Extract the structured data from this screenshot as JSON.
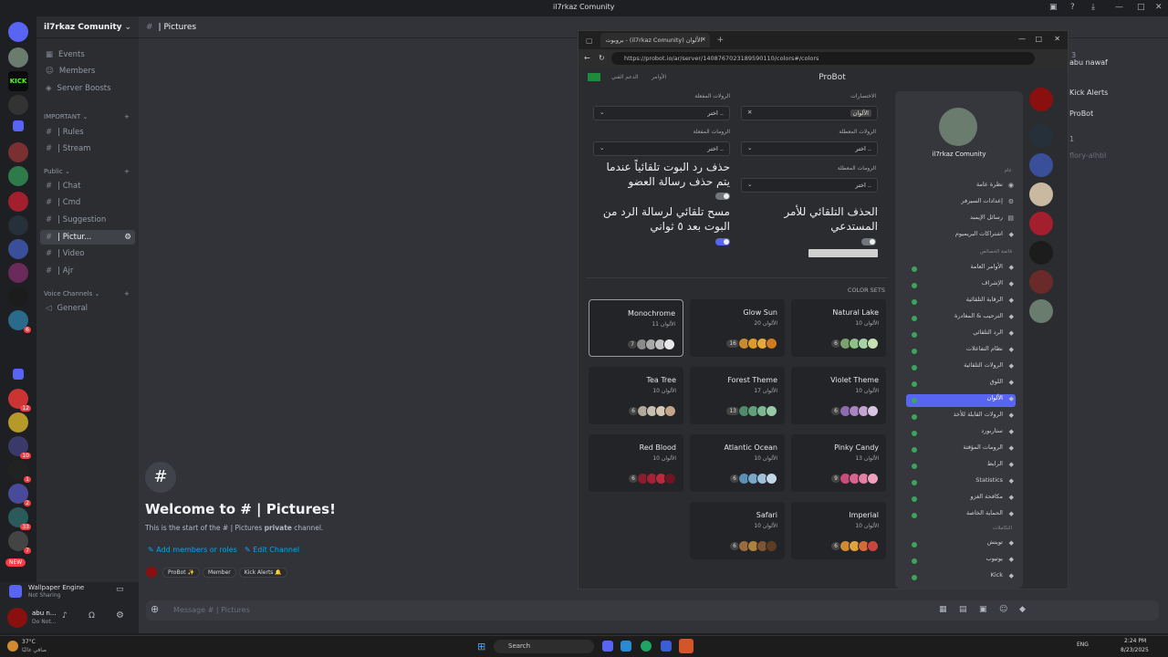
{
  "window": {
    "title": "il7rkaz Comunity"
  },
  "server": {
    "name": "il7rkaz Comunity",
    "badges": [
      "6",
      "12",
      "1",
      "10",
      "1",
      "2",
      "33",
      "7",
      "NEW"
    ]
  },
  "nav": {
    "events": "Events",
    "members": "Members",
    "boosts": "Server Boosts"
  },
  "categories": {
    "important": "IMPORTANT",
    "public": "Public",
    "voice": "Voice Channels"
  },
  "channels": {
    "rules": "| Rules",
    "stream": "| Stream",
    "chat": "| Chat",
    "cmd": "| Cmd",
    "suggestion": "| Suggestion",
    "pictures": "| Pictur...",
    "video": "| Video",
    "ajr": "| Ajr",
    "general": "General"
  },
  "header": {
    "channel": "| Pictures"
  },
  "welcome": {
    "title": "Welcome to # | Pictures!",
    "desc_a": "This is the start of the # ",
    "desc_b": "| Pictures ",
    "desc_c": "private",
    "desc_d": " channel.",
    "add": "Add members or roles",
    "edit": "Edit Channel",
    "roles": [
      "ProBot ✨",
      "Member",
      "Kick Alerts 🔔"
    ]
  },
  "composer": {
    "placeholder": "Message # | Pictures"
  },
  "user": {
    "name": "abu n...",
    "status": "Do Not...",
    "app": "Wallpaper Engine",
    "app_status": "Not Sharing"
  },
  "members_ghost": {
    "a": "abu nawaf",
    "b": "Kick Alerts",
    "c": "ProBot",
    "app": "APP",
    "d": "1",
    "e": "flory-alhbl",
    "f": "3"
  },
  "browser": {
    "tab": "بروبوت - (il7rkaz Comunity) الألوان",
    "url": "https://probot.io/ar/server/1408767023189590110/colors#/colors"
  },
  "probot": {
    "title": "ProBot",
    "support": "الدعم الفني",
    "commands": "الأوامر",
    "guild": "il7rkaz Comunity"
  },
  "form": {
    "l1": "الرولات المفعلة",
    "l2": "الاختصارات",
    "l3": "الرومات المفعلة",
    "l4": "الرولات المعطلة",
    "l5": "الرومات المعطلة",
    "choose": "اختر ..",
    "chip": "الألوان",
    "t1": "حذف رد البوت تلقائياً عندما يتم حذف رسالة العضو",
    "t2": "مسح تلقائي لرسالة الرد من البوت بعد ٥ ثواني",
    "t3": "الحذف التلقائي للأمر المستدعي"
  },
  "colorsets": {
    "label": "COLOR SETS",
    "items": [
      {
        "name": "Natural Lake",
        "count": "10 الألوان",
        "n": "6",
        "colors": [
          "#7aa06b",
          "#8fbf88",
          "#a6d4a6",
          "#c7e0b3"
        ]
      },
      {
        "name": "Glow Sun",
        "count": "20 الألوان",
        "n": "16",
        "colors": [
          "#c9892f",
          "#dc9a2c",
          "#e7a83a",
          "#d17b20"
        ]
      },
      {
        "name": "Monochrome",
        "count": "11 الألوان",
        "n": "7",
        "colors": [
          "#8a8a8a",
          "#a8a8a8",
          "#c4c4c4",
          "#e8e8e8"
        ]
      },
      {
        "name": "Violet Theme",
        "count": "10 الألوان",
        "n": "6",
        "colors": [
          "#8e6bb0",
          "#a884c0",
          "#c4a3d3",
          "#d8c4e3"
        ]
      },
      {
        "name": "Forest Theme",
        "count": "17 الألوان",
        "n": "13",
        "colors": [
          "#4f8a6a",
          "#62a07c",
          "#7bb891",
          "#96c9a6"
        ]
      },
      {
        "name": "Tea Tree",
        "count": "10 الألوان",
        "n": "6",
        "colors": [
          "#b0a89a",
          "#c6bdb0",
          "#d4c6b2",
          "#c4a58a"
        ]
      },
      {
        "name": "Pinky Candy",
        "count": "13 الألوان",
        "n": "9",
        "colors": [
          "#c94d7a",
          "#d9638e",
          "#e47fa4",
          "#eca0bb"
        ]
      },
      {
        "name": "Atlantic Ocean",
        "count": "10 الألوان",
        "n": "6",
        "colors": [
          "#5c8fb5",
          "#7aa7c9",
          "#9ec0d9",
          "#c3d8e7"
        ]
      },
      {
        "name": "Red Blood",
        "count": "10 الألوان",
        "n": "6",
        "colors": [
          "#8a1d2e",
          "#a32234",
          "#b82a3c",
          "#6e1523"
        ]
      },
      {
        "name": "Imperial",
        "count": "10 الألوان",
        "n": "6",
        "colors": [
          "#d18a2f",
          "#e0a33b",
          "#d4693a",
          "#c9463f"
        ]
      },
      {
        "name": "Safari",
        "count": "10 الألوان",
        "n": "6",
        "colors": [
          "#9a6b3d",
          "#b0803f",
          "#7d5530",
          "#5c3c22"
        ]
      }
    ]
  },
  "menu": {
    "general": "عام",
    "s1": "نظرة عامة",
    "s2": "إعدادات السيرفر",
    "s3": "رسائل الإيمبد",
    "s4": "اشتراكات البريميوم",
    "fsec": "قائمة الخصائص",
    "items": [
      "الأوامر العامة",
      "الإشراف",
      "الرقابة التلقائية",
      "الترحيب & المغادرة",
      "الرد التلقائي",
      "نظام التفاعلات",
      "الرولات التلقائية",
      "اللوق",
      "الألوان",
      "الرولات القابلة للأخذ",
      "ستاربورد",
      "الرومات المؤقتة",
      "الرابط",
      "Statistics",
      "مكافحة الغزو",
      "الحماية الخاصة"
    ],
    "isec": "التكاملات",
    "integ": [
      "تويتش",
      "يوتيوب",
      "Kick"
    ]
  },
  "taskbar": {
    "search": "Search",
    "temp": "37°C",
    "weather": "صافي غالبًا",
    "lang": "ENG",
    "time": "2:24 PM",
    "date": "8/23/2025"
  }
}
